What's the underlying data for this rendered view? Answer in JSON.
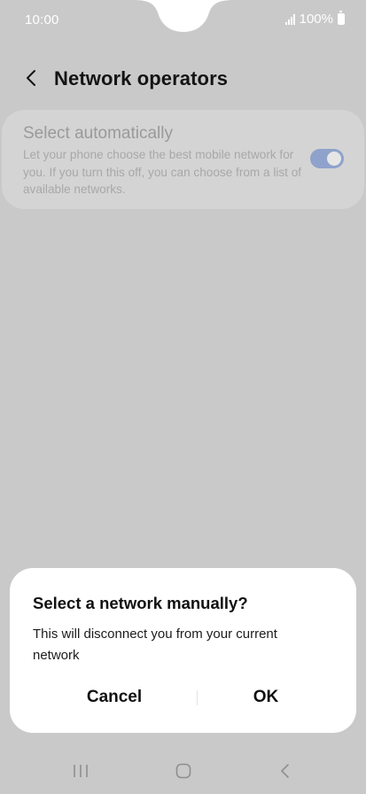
{
  "status_bar": {
    "time": "10:00",
    "battery_text": "100%",
    "icons": [
      "signal-icon",
      "battery-icon"
    ]
  },
  "header": {
    "title": "Network operators",
    "back_icon": "chevron-left-icon"
  },
  "settings": {
    "select_automatically": {
      "title": "Select automatically",
      "description": "Let your phone choose the best mobile network for you. If you turn this off, you can choose from a list of available networks.",
      "enabled": true
    }
  },
  "dialog": {
    "title": "Select a network manually?",
    "message": "This will disconnect you from your current network",
    "cancel_label": "Cancel",
    "ok_label": "OK"
  },
  "nav_bar": {
    "icons": [
      "recents-icon",
      "home-icon",
      "back-icon"
    ]
  },
  "colors": {
    "scrim_background": "#c9c9c9",
    "dialog_background": "#ffffff",
    "toggle_on": "#8fa2cc",
    "status_text": "#ffffff"
  }
}
